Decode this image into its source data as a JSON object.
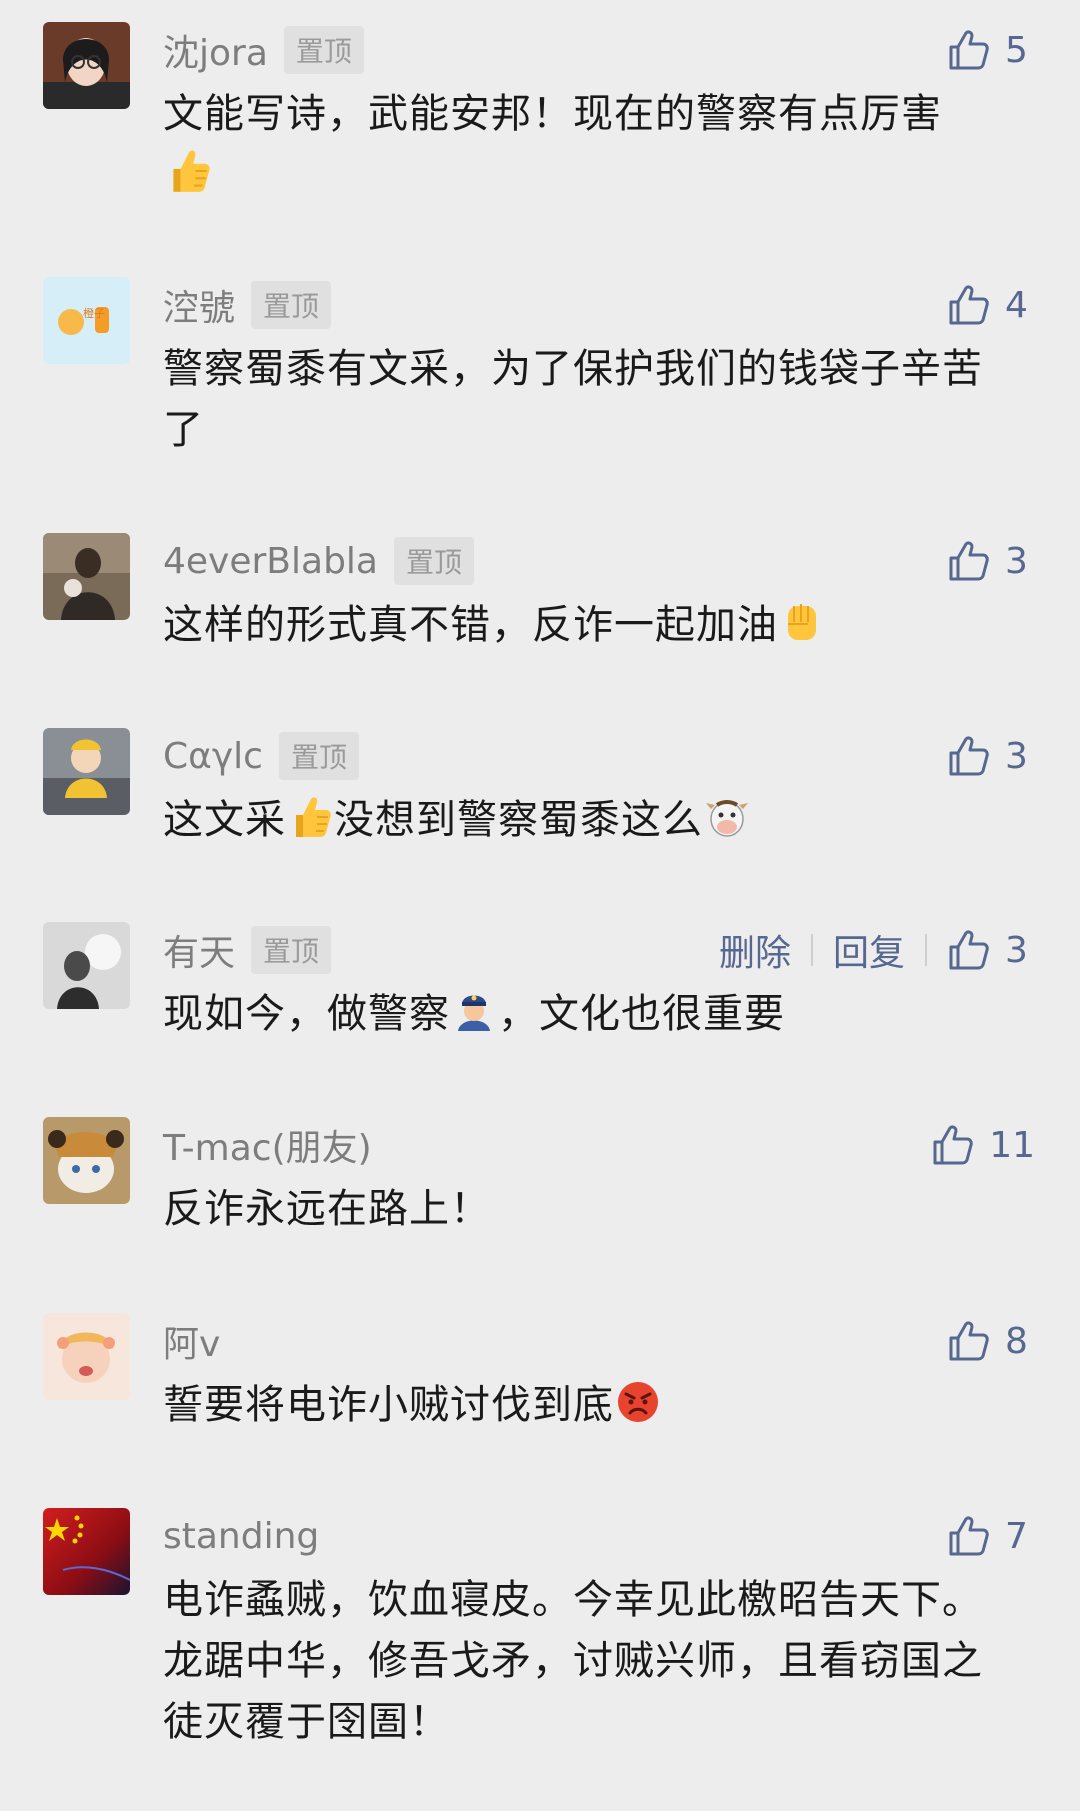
{
  "pinned_label": "置顶",
  "comments": [
    {
      "name": "沈jora",
      "text": "文能写诗，武能安邦！现在的警察有点厉害",
      "emoji": "thumbs-up",
      "likes": "5"
    },
    {
      "name": "涳號",
      "text": "警察蜀黍有文采，为了保护我们的钱袋子辛苦了",
      "likes": "4"
    },
    {
      "name": "4everBlabla",
      "text": "这样的形式真不错，反诈一起加油",
      "emoji": "raised-fist",
      "likes": "3"
    },
    {
      "name": "Cαγlc",
      "text_a": "这文采",
      "text_b": "没想到警察蜀黍这么",
      "emoji_a": "thumbs-up",
      "emoji_b": "cow-face",
      "likes": "3"
    },
    {
      "name": "有天",
      "text_a": "现如今，做警察",
      "text_b": "，文化也很重要",
      "emoji": "police-officer",
      "delete_label": "删除",
      "reply_label": "回复",
      "likes": "3"
    },
    {
      "name": "T-mac(朋友)",
      "text": "反诈永远在路上！",
      "likes": "11"
    },
    {
      "name": "阿v",
      "text": "誓要将电诈小贼讨伐到底",
      "emoji": "angry-face",
      "likes": "8"
    },
    {
      "name": "standing",
      "text": "电诈蟊贼，饮血寝皮。今幸见此檄昭告天下。龙踞中华，修吾戈矛，讨贼兴师，且看窃国之徒灭覆于囹圄！",
      "likes": "7"
    }
  ],
  "colors": {
    "background": "#ededed",
    "name": "#7d7d7d",
    "text": "#1a1a1a",
    "link": "#56688f",
    "pin_bg": "#e0e0e0"
  }
}
